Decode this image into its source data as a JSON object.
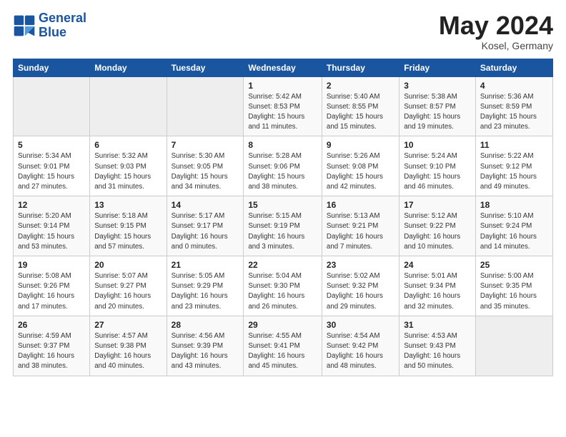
{
  "header": {
    "logo_general": "General",
    "logo_blue": "Blue",
    "title": "May 2024",
    "subtitle": "Kosel, Germany"
  },
  "weekdays": [
    "Sunday",
    "Monday",
    "Tuesday",
    "Wednesday",
    "Thursday",
    "Friday",
    "Saturday"
  ],
  "weeks": [
    [
      {
        "num": "",
        "sunrise": "",
        "sunset": "",
        "daylight": "",
        "empty": true
      },
      {
        "num": "",
        "sunrise": "",
        "sunset": "",
        "daylight": "",
        "empty": true
      },
      {
        "num": "",
        "sunrise": "",
        "sunset": "",
        "daylight": "",
        "empty": true
      },
      {
        "num": "1",
        "sunrise": "Sunrise: 5:42 AM",
        "sunset": "Sunset: 8:53 PM",
        "daylight": "Daylight: 15 hours and 11 minutes.",
        "empty": false
      },
      {
        "num": "2",
        "sunrise": "Sunrise: 5:40 AM",
        "sunset": "Sunset: 8:55 PM",
        "daylight": "Daylight: 15 hours and 15 minutes.",
        "empty": false
      },
      {
        "num": "3",
        "sunrise": "Sunrise: 5:38 AM",
        "sunset": "Sunset: 8:57 PM",
        "daylight": "Daylight: 15 hours and 19 minutes.",
        "empty": false
      },
      {
        "num": "4",
        "sunrise": "Sunrise: 5:36 AM",
        "sunset": "Sunset: 8:59 PM",
        "daylight": "Daylight: 15 hours and 23 minutes.",
        "empty": false
      }
    ],
    [
      {
        "num": "5",
        "sunrise": "Sunrise: 5:34 AM",
        "sunset": "Sunset: 9:01 PM",
        "daylight": "Daylight: 15 hours and 27 minutes.",
        "empty": false
      },
      {
        "num": "6",
        "sunrise": "Sunrise: 5:32 AM",
        "sunset": "Sunset: 9:03 PM",
        "daylight": "Daylight: 15 hours and 31 minutes.",
        "empty": false
      },
      {
        "num": "7",
        "sunrise": "Sunrise: 5:30 AM",
        "sunset": "Sunset: 9:05 PM",
        "daylight": "Daylight: 15 hours and 34 minutes.",
        "empty": false
      },
      {
        "num": "8",
        "sunrise": "Sunrise: 5:28 AM",
        "sunset": "Sunset: 9:06 PM",
        "daylight": "Daylight: 15 hours and 38 minutes.",
        "empty": false
      },
      {
        "num": "9",
        "sunrise": "Sunrise: 5:26 AM",
        "sunset": "Sunset: 9:08 PM",
        "daylight": "Daylight: 15 hours and 42 minutes.",
        "empty": false
      },
      {
        "num": "10",
        "sunrise": "Sunrise: 5:24 AM",
        "sunset": "Sunset: 9:10 PM",
        "daylight": "Daylight: 15 hours and 46 minutes.",
        "empty": false
      },
      {
        "num": "11",
        "sunrise": "Sunrise: 5:22 AM",
        "sunset": "Sunset: 9:12 PM",
        "daylight": "Daylight: 15 hours and 49 minutes.",
        "empty": false
      }
    ],
    [
      {
        "num": "12",
        "sunrise": "Sunrise: 5:20 AM",
        "sunset": "Sunset: 9:14 PM",
        "daylight": "Daylight: 15 hours and 53 minutes.",
        "empty": false
      },
      {
        "num": "13",
        "sunrise": "Sunrise: 5:18 AM",
        "sunset": "Sunset: 9:15 PM",
        "daylight": "Daylight: 15 hours and 57 minutes.",
        "empty": false
      },
      {
        "num": "14",
        "sunrise": "Sunrise: 5:17 AM",
        "sunset": "Sunset: 9:17 PM",
        "daylight": "Daylight: 16 hours and 0 minutes.",
        "empty": false
      },
      {
        "num": "15",
        "sunrise": "Sunrise: 5:15 AM",
        "sunset": "Sunset: 9:19 PM",
        "daylight": "Daylight: 16 hours and 3 minutes.",
        "empty": false
      },
      {
        "num": "16",
        "sunrise": "Sunrise: 5:13 AM",
        "sunset": "Sunset: 9:21 PM",
        "daylight": "Daylight: 16 hours and 7 minutes.",
        "empty": false
      },
      {
        "num": "17",
        "sunrise": "Sunrise: 5:12 AM",
        "sunset": "Sunset: 9:22 PM",
        "daylight": "Daylight: 16 hours and 10 minutes.",
        "empty": false
      },
      {
        "num": "18",
        "sunrise": "Sunrise: 5:10 AM",
        "sunset": "Sunset: 9:24 PM",
        "daylight": "Daylight: 16 hours and 14 minutes.",
        "empty": false
      }
    ],
    [
      {
        "num": "19",
        "sunrise": "Sunrise: 5:08 AM",
        "sunset": "Sunset: 9:26 PM",
        "daylight": "Daylight: 16 hours and 17 minutes.",
        "empty": false
      },
      {
        "num": "20",
        "sunrise": "Sunrise: 5:07 AM",
        "sunset": "Sunset: 9:27 PM",
        "daylight": "Daylight: 16 hours and 20 minutes.",
        "empty": false
      },
      {
        "num": "21",
        "sunrise": "Sunrise: 5:05 AM",
        "sunset": "Sunset: 9:29 PM",
        "daylight": "Daylight: 16 hours and 23 minutes.",
        "empty": false
      },
      {
        "num": "22",
        "sunrise": "Sunrise: 5:04 AM",
        "sunset": "Sunset: 9:30 PM",
        "daylight": "Daylight: 16 hours and 26 minutes.",
        "empty": false
      },
      {
        "num": "23",
        "sunrise": "Sunrise: 5:02 AM",
        "sunset": "Sunset: 9:32 PM",
        "daylight": "Daylight: 16 hours and 29 minutes.",
        "empty": false
      },
      {
        "num": "24",
        "sunrise": "Sunrise: 5:01 AM",
        "sunset": "Sunset: 9:34 PM",
        "daylight": "Daylight: 16 hours and 32 minutes.",
        "empty": false
      },
      {
        "num": "25",
        "sunrise": "Sunrise: 5:00 AM",
        "sunset": "Sunset: 9:35 PM",
        "daylight": "Daylight: 16 hours and 35 minutes.",
        "empty": false
      }
    ],
    [
      {
        "num": "26",
        "sunrise": "Sunrise: 4:59 AM",
        "sunset": "Sunset: 9:37 PM",
        "daylight": "Daylight: 16 hours and 38 minutes.",
        "empty": false
      },
      {
        "num": "27",
        "sunrise": "Sunrise: 4:57 AM",
        "sunset": "Sunset: 9:38 PM",
        "daylight": "Daylight: 16 hours and 40 minutes.",
        "empty": false
      },
      {
        "num": "28",
        "sunrise": "Sunrise: 4:56 AM",
        "sunset": "Sunset: 9:39 PM",
        "daylight": "Daylight: 16 hours and 43 minutes.",
        "empty": false
      },
      {
        "num": "29",
        "sunrise": "Sunrise: 4:55 AM",
        "sunset": "Sunset: 9:41 PM",
        "daylight": "Daylight: 16 hours and 45 minutes.",
        "empty": false
      },
      {
        "num": "30",
        "sunrise": "Sunrise: 4:54 AM",
        "sunset": "Sunset: 9:42 PM",
        "daylight": "Daylight: 16 hours and 48 minutes.",
        "empty": false
      },
      {
        "num": "31",
        "sunrise": "Sunrise: 4:53 AM",
        "sunset": "Sunset: 9:43 PM",
        "daylight": "Daylight: 16 hours and 50 minutes.",
        "empty": false
      },
      {
        "num": "",
        "sunrise": "",
        "sunset": "",
        "daylight": "",
        "empty": true
      }
    ]
  ]
}
